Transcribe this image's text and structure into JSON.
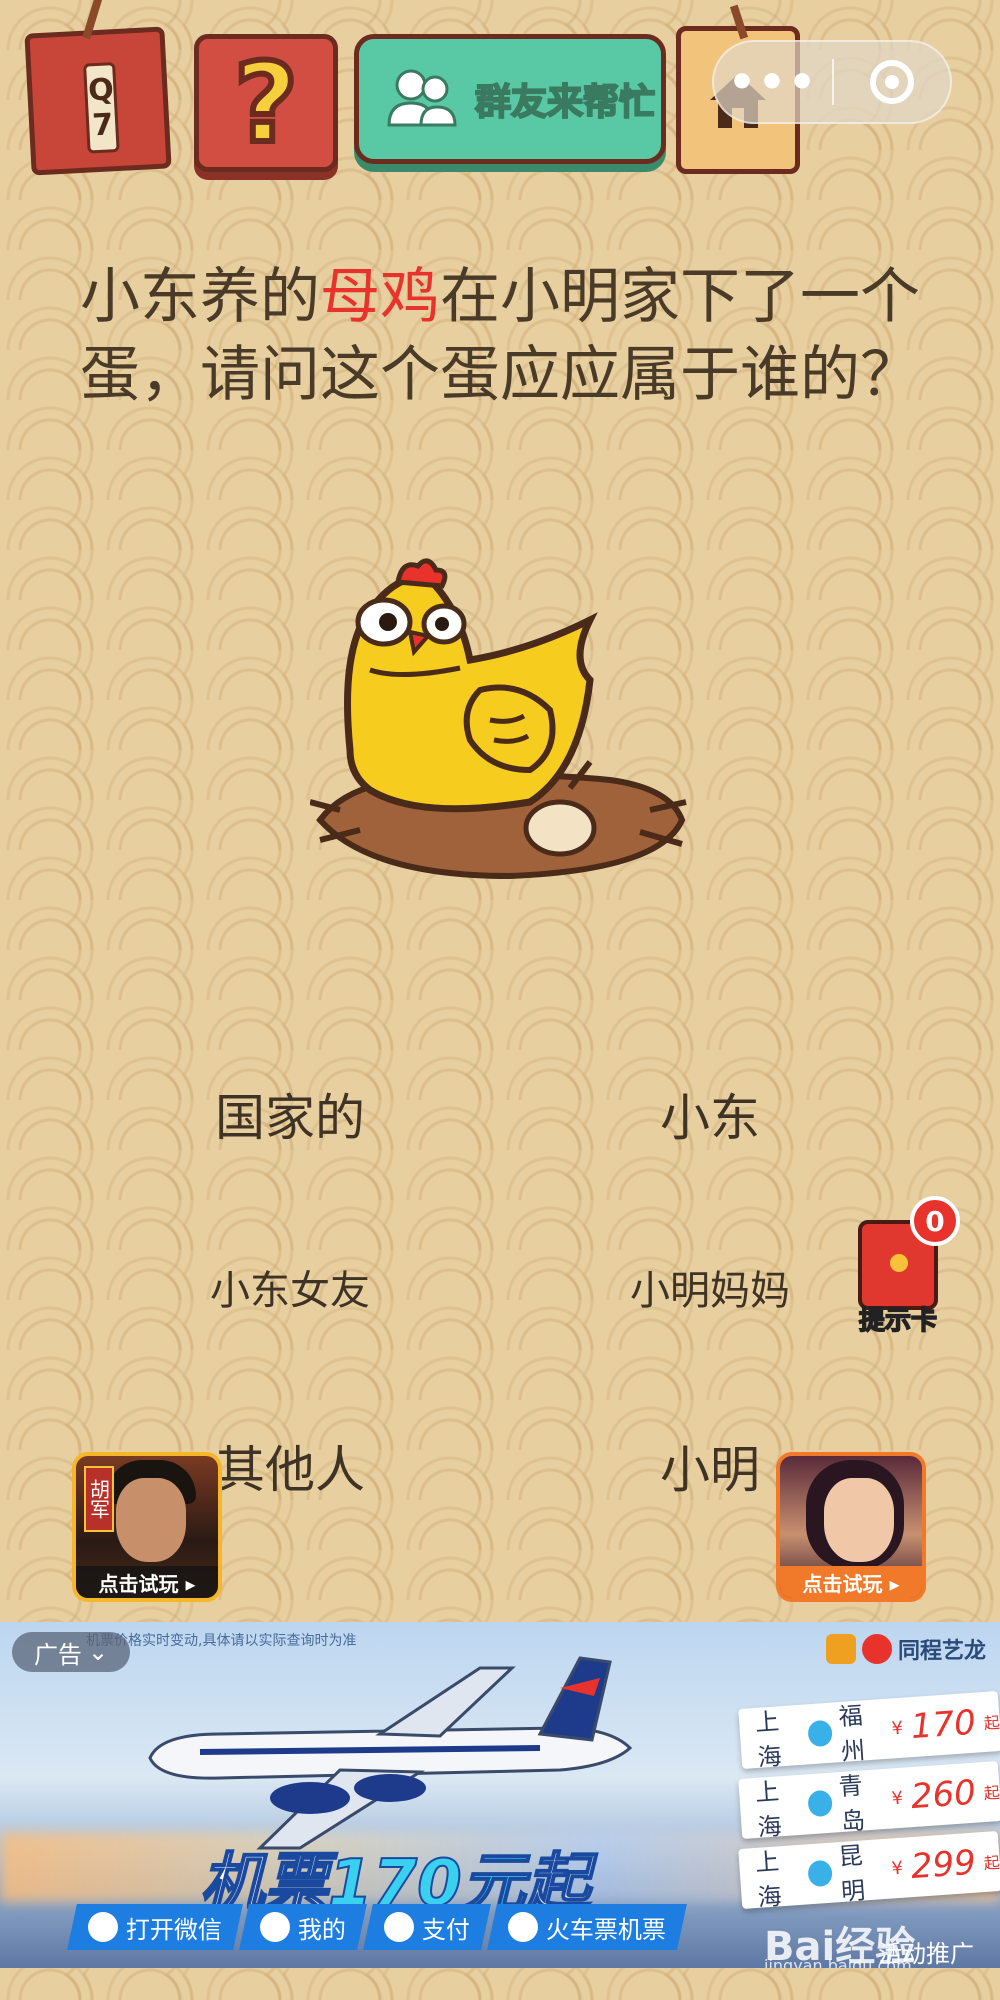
{
  "level": {
    "label": "Q7"
  },
  "toolbar": {
    "help_icon": "question-mark-icon",
    "group_help_label": "群友来帮忙",
    "home_icon": "home-icon",
    "capsule_more": "•••",
    "capsule_close_icon": "target-icon"
  },
  "question": {
    "before": "小东养的",
    "highlight": "母鸡",
    "after": "在小明家下了一个蛋，请问这个蛋应应属于谁的？",
    "highlight_color": "#e8322c"
  },
  "answers": [
    {
      "label": "国家的"
    },
    {
      "label": "小东"
    },
    {
      "label": "小东女友"
    },
    {
      "label": "小明妈妈"
    },
    {
      "label": "其他人"
    },
    {
      "label": "小明"
    }
  ],
  "hint_card": {
    "count": "0",
    "label": "提示卡"
  },
  "game_ads": [
    {
      "seal": "胡军",
      "cta": "点击试玩 ▸"
    },
    {
      "cta": "点击试玩 ▸"
    }
  ],
  "banner_ad": {
    "ad_label": "广告",
    "disclaimer": "机票价格实时变动,具体请以实际查询时为准",
    "brand": "同程艺龙",
    "headline_prefix": "机票",
    "headline_number": "170元",
    "headline_suffix": "起",
    "routes": [
      {
        "from": "上海",
        "to": "福州",
        "currency": "¥",
        "price": "170",
        "suffix": "起"
      },
      {
        "from": "上海",
        "to": "青岛",
        "currency": "¥",
        "price": "260",
        "suffix": "起"
      },
      {
        "from": "上海",
        "to": "昆明",
        "currency": "¥",
        "price": "299",
        "suffix": "起"
      }
    ],
    "actions": [
      {
        "label": "打开微信",
        "icon": "wechat-icon"
      },
      {
        "label": "我的",
        "icon": "user-icon"
      },
      {
        "label": "支付",
        "icon": "pay-icon"
      },
      {
        "label": "火车票机票",
        "icon": "train-icon"
      }
    ]
  },
  "watermark": {
    "baidu": "Bai经验",
    "promo": "活动推广",
    "url": "jingyan.baidu.com"
  },
  "colors": {
    "background": "#e7cfa0",
    "accent_red": "#e8322c",
    "teal": "#58c9a4"
  }
}
